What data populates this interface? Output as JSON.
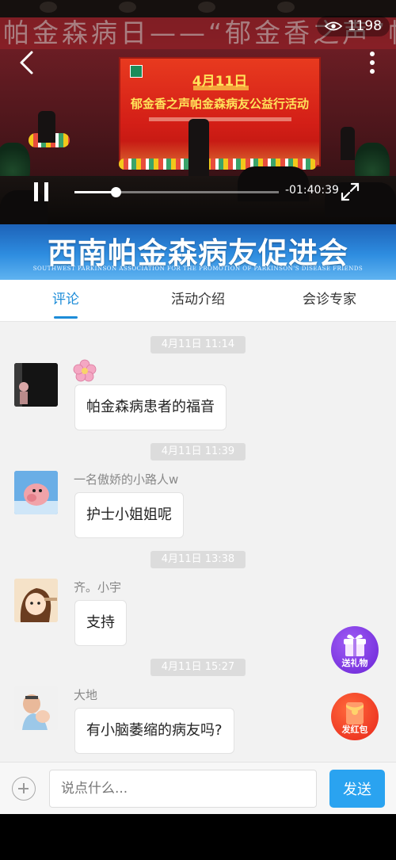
{
  "video": {
    "view_count": "1198",
    "background_banner": "帕金森病日——“郁金香之声”帕金森",
    "screen_date": "4月11日",
    "screen_headline": "郁金香之声帕金森病友公益行活动",
    "time_remaining": "-01:40:39",
    "progress": 0.2
  },
  "association": {
    "title": "西南帕金森病友促进会",
    "subtitle": "SOUTHWEST PARKINSON ASSOCIATION FOR THE PROMOTION OF PARKINSON'S DISEASE FRIENDS"
  },
  "tabs": [
    {
      "label": "评论",
      "active": true
    },
    {
      "label": "活动介绍",
      "active": false
    },
    {
      "label": "会诊专家",
      "active": false
    }
  ],
  "messages": [
    {
      "time": "4月11日 11:14",
      "nickname": "",
      "text": "帕金森病患者的福音",
      "has_flower_sticker": true
    },
    {
      "time": "4月11日 11:39",
      "nickname": "一名傲娇的小路人w",
      "text": "护士小姐姐呢"
    },
    {
      "time": "4月11日 13:38",
      "nickname": "齐。小宇",
      "text": "支持"
    },
    {
      "time": "4月11日 15:27",
      "nickname": "大地",
      "text": "有小脑萎缩的病友吗?"
    }
  ],
  "floating": {
    "gift_label": "送礼物",
    "red_packet_label": "发红包"
  },
  "input": {
    "placeholder": "说点什么...",
    "send_label": "发送"
  },
  "colors": {
    "accent": "#1d8cd8",
    "send_button": "#2aa3f0",
    "chat_background": "#f2f2f2"
  }
}
